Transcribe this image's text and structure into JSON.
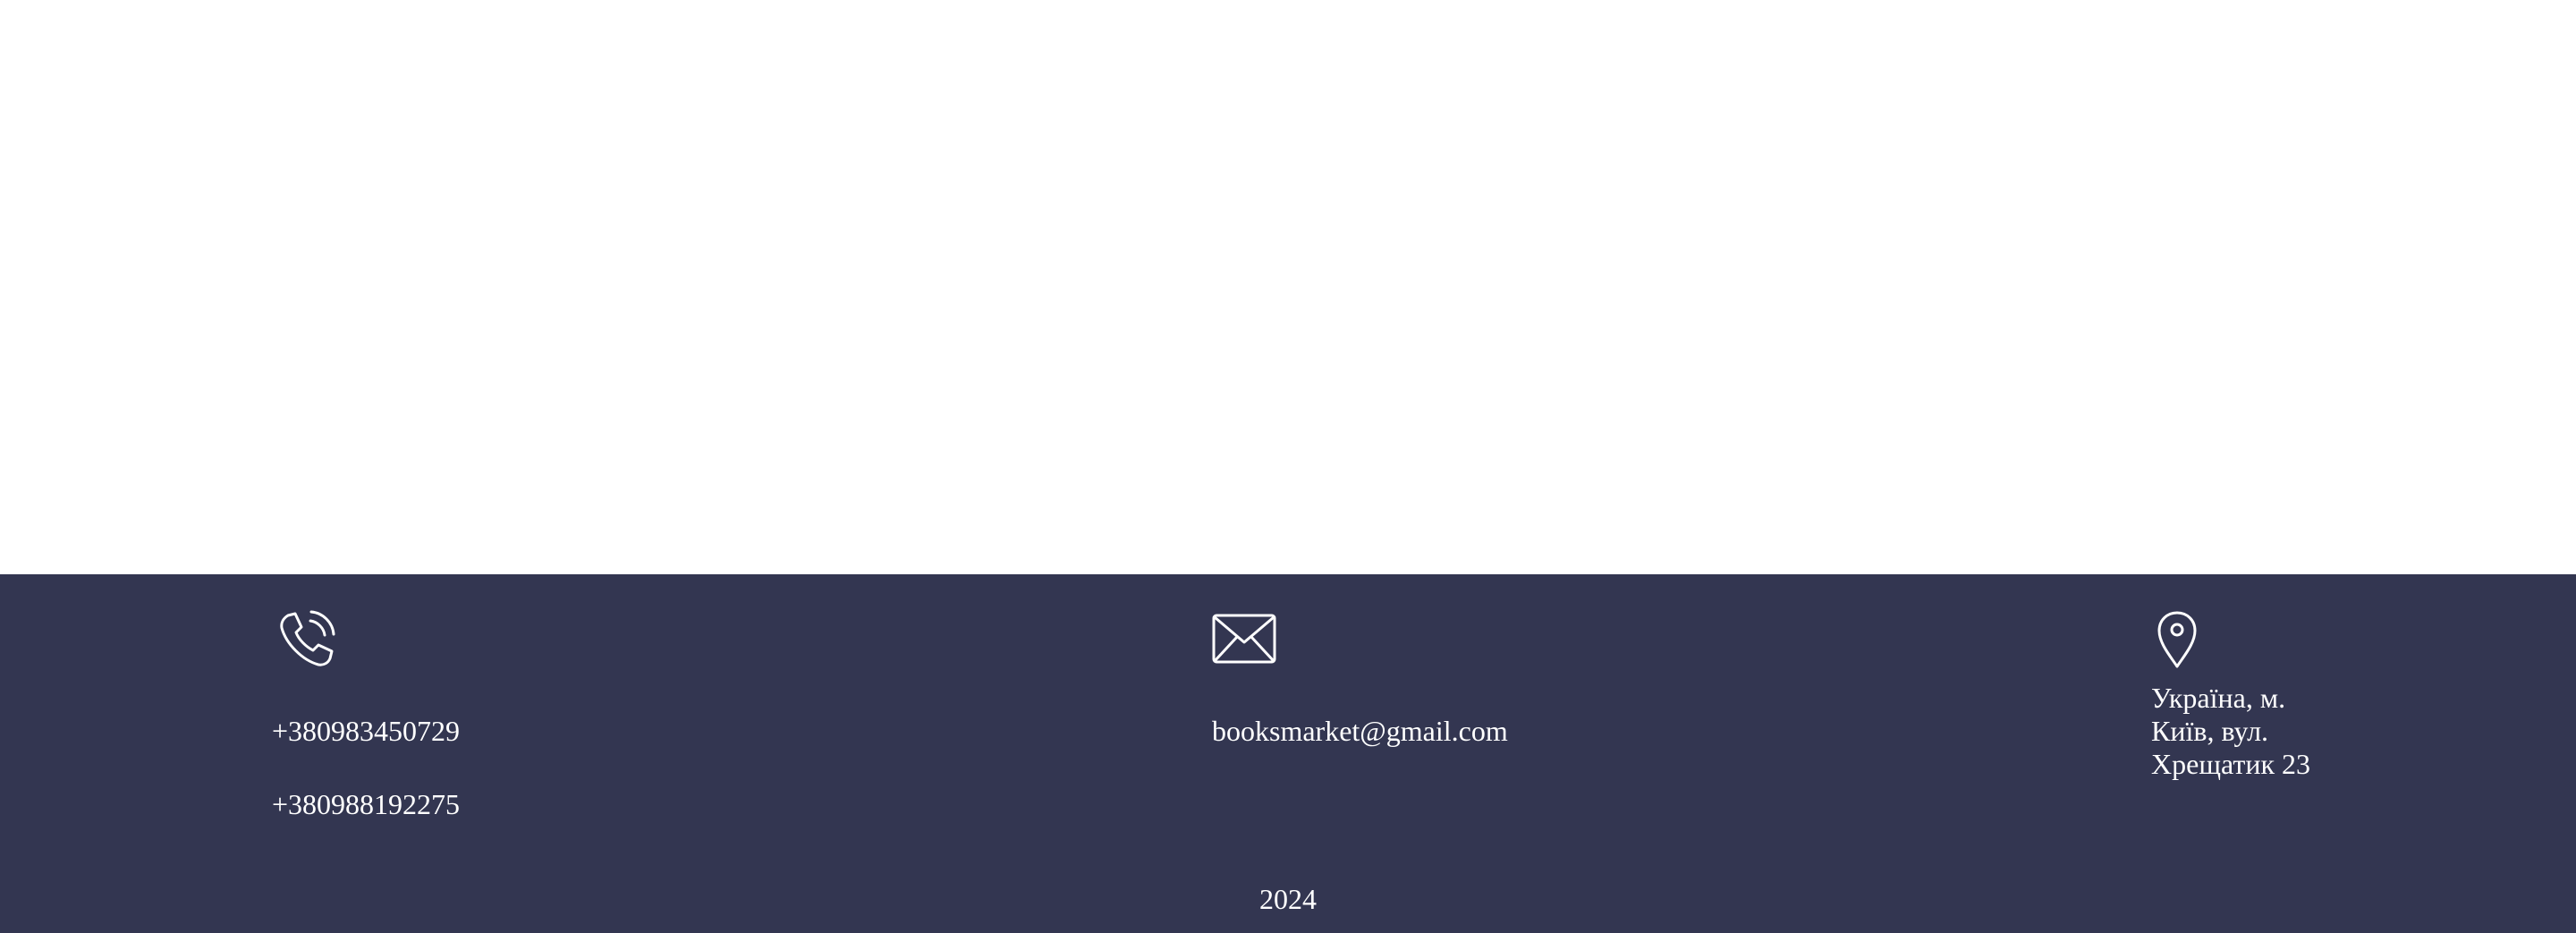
{
  "footer": {
    "background_color": "#333651",
    "text_color": "#ffffff",
    "phone": {
      "icon": "phone-icon",
      "numbers": [
        "+380983450729",
        "+380988192275"
      ]
    },
    "email": {
      "icon": "envelope-icon",
      "address": "booksmarket@gmail.com"
    },
    "location": {
      "icon": "map-pin-icon",
      "address": "Україна, м. Київ, вул. Хрещатик 23"
    },
    "year": "2024"
  }
}
